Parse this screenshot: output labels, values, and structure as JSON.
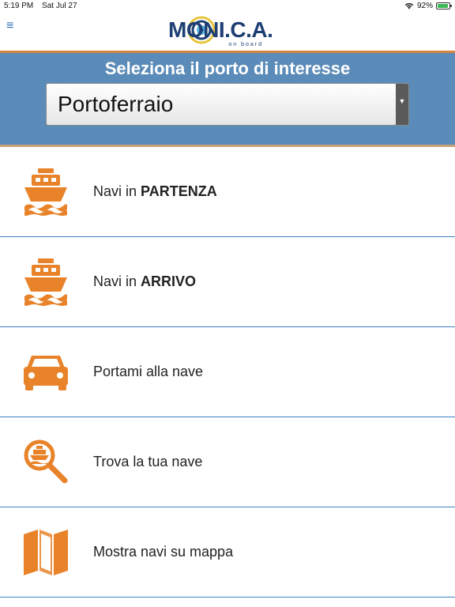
{
  "status_bar": {
    "time": "5:19 PM",
    "date": "Sat Jul 27",
    "battery": "92%",
    "battery_level": 0.92
  },
  "header": {
    "logo_main": "MONI.C.A.",
    "logo_sub": "on board"
  },
  "port_panel": {
    "title": "Seleziona il porto di interesse",
    "selected_port": "Portoferraio"
  },
  "menu": {
    "items": [
      {
        "prefix": "Navi in ",
        "bold": "PARTENZA",
        "icon": "ship-departure-icon"
      },
      {
        "prefix": "Navi in ",
        "bold": "ARRIVO",
        "icon": "ship-arrival-icon"
      },
      {
        "prefix": "Portami alla nave",
        "bold": "",
        "icon": "car-icon"
      },
      {
        "prefix": "Trova la tua nave",
        "bold": "",
        "icon": "search-ship-icon"
      },
      {
        "prefix": "Mostra navi su mappa",
        "bold": "",
        "icon": "map-icon"
      }
    ]
  },
  "colors": {
    "accent": "#e8832a",
    "panel": "#5b8bb8",
    "divider": "#3f7ec4",
    "logo": "#1d3f73"
  }
}
